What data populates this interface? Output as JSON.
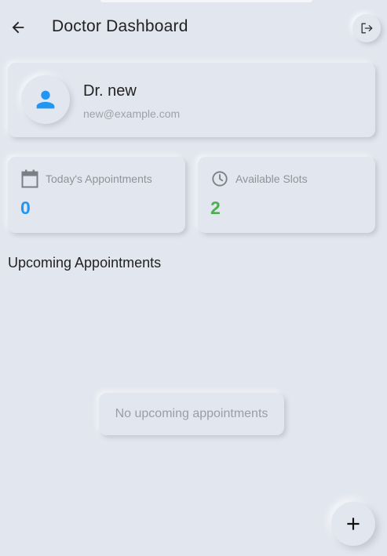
{
  "header": {
    "title": "Doctor Dashboard",
    "back_icon": "arrow-left-icon",
    "logout_icon": "logout-icon"
  },
  "profile": {
    "name": "Dr. new",
    "email": "new@example.com",
    "avatar_icon": "person-icon"
  },
  "stats": [
    {
      "label": "Today's Appointments",
      "value": "0",
      "icon": "calendar-icon",
      "color": "#2196f3"
    },
    {
      "label": "Available Slots",
      "value": "2",
      "icon": "clock-icon",
      "color": "#4caf50"
    }
  ],
  "appointments": {
    "section_title": "Upcoming Appointments",
    "empty_message": "No upcoming appointments"
  },
  "fab": {
    "icon": "plus-icon"
  },
  "colors": {
    "background": "#e2e6ee",
    "accent_blue": "#2196f3",
    "accent_green": "#4caf50"
  }
}
